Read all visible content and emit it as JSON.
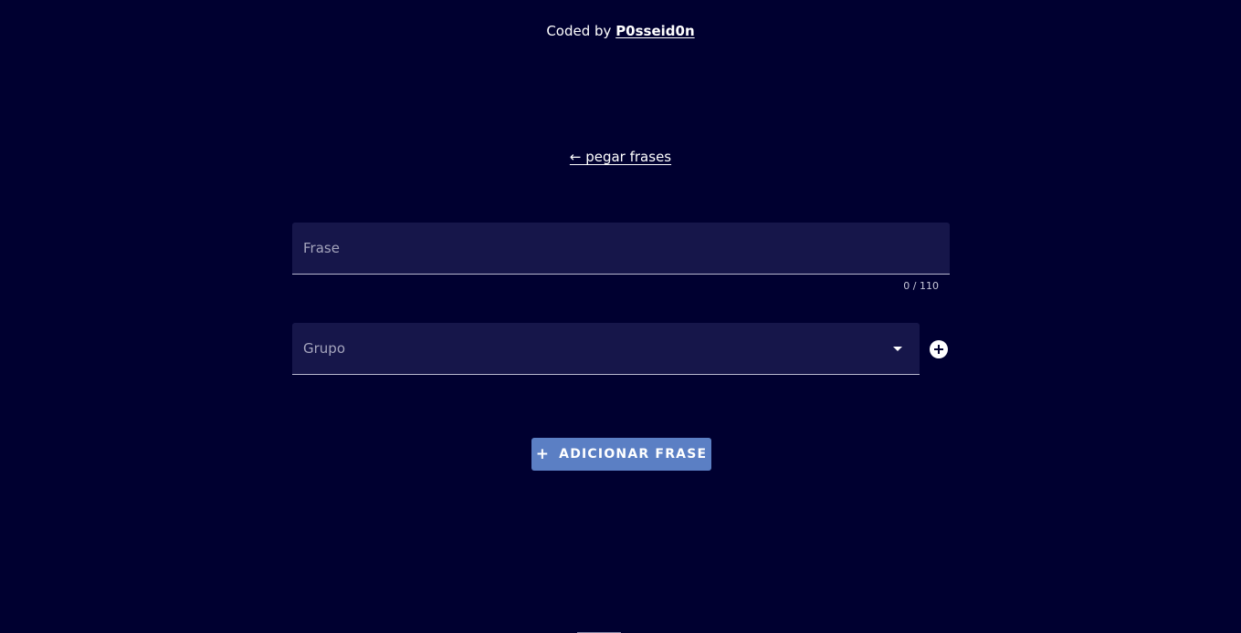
{
  "credit": {
    "prefix": "Coded by ",
    "author": "P0sseid0n"
  },
  "nav": {
    "back_link": "← pegar frases"
  },
  "form": {
    "frase": {
      "label": "Frase",
      "counter": "0 / 110"
    },
    "grupo": {
      "label": "Grupo",
      "arrow_icon": "chevron-down-icon",
      "add_icon": "plus-circle-icon"
    },
    "submit": {
      "icon": "+",
      "label": "ADICIONAR FRASE"
    }
  },
  "colors": {
    "background": "#000030",
    "field": "#16164a",
    "button": "#5b7fc4"
  }
}
